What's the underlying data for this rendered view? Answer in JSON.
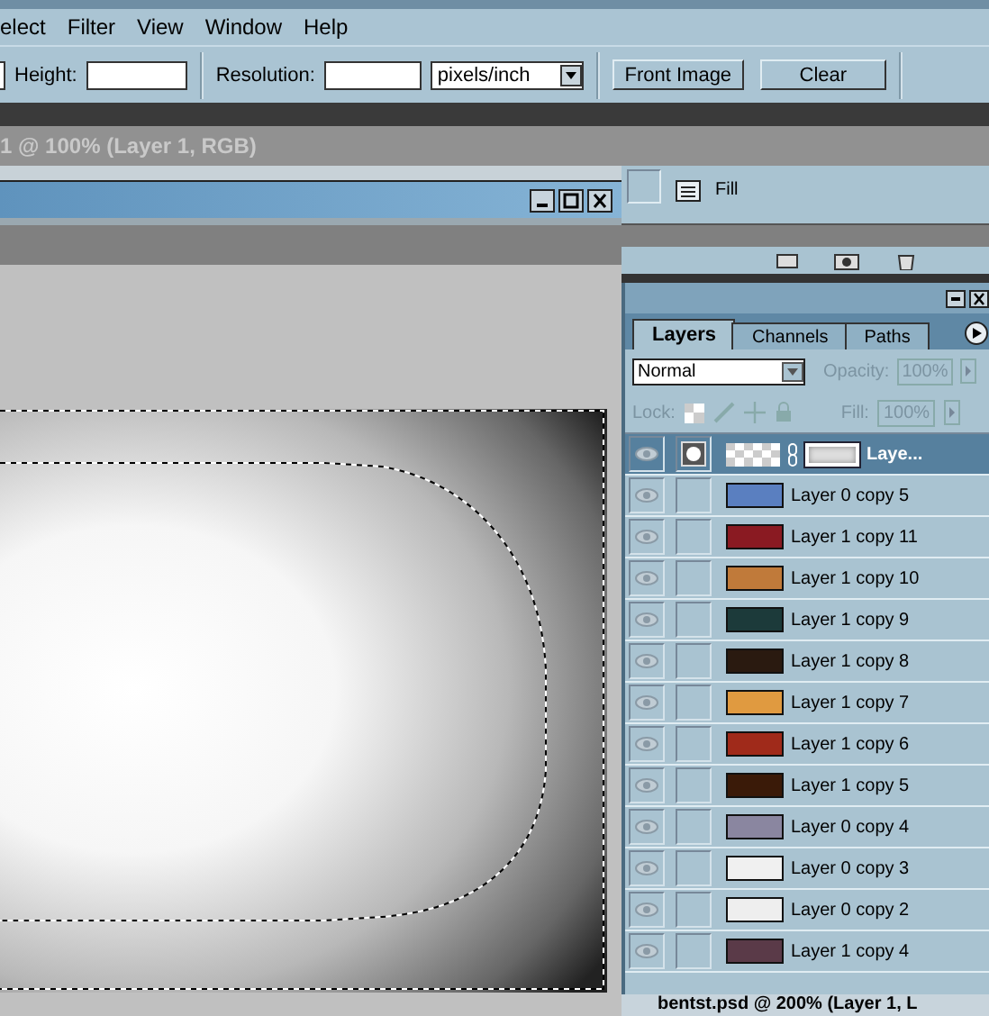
{
  "menu": [
    "elect",
    "Filter",
    "View",
    "Window",
    "Help"
  ],
  "options_bar": {
    "height_label": "Height:",
    "resolution_label": "Resolution:",
    "unit": "pixels/inch",
    "buttons": [
      "Front Image",
      "Clear"
    ]
  },
  "document_title": "1 @ 100% (Layer 1, RGB)",
  "actions_panel": {
    "item": "Fill"
  },
  "layers_palette": {
    "tabs": [
      {
        "label": "Layers",
        "selected": true
      },
      {
        "label": "Channels",
        "selected": false
      },
      {
        "label": "Paths",
        "selected": false
      }
    ],
    "blend_mode": "Normal",
    "opacity_label": "Opacity:",
    "opacity": "100%",
    "lock_label": "Lock:",
    "fill_label": "Fill:",
    "fill": "100%",
    "layers": [
      {
        "name": "Laye...",
        "kind": "mask",
        "selected": true,
        "color": "#ffffff"
      },
      {
        "name": "Layer 0 copy 5",
        "kind": "image",
        "selected": false,
        "color": "#5a7fc0"
      },
      {
        "name": "Layer 1 copy 11",
        "kind": "image",
        "selected": false,
        "color": "#8a1a22"
      },
      {
        "name": "Layer 1 copy 10",
        "kind": "image",
        "selected": false,
        "color": "#c07a3a"
      },
      {
        "name": "Layer 1 copy 9",
        "kind": "image",
        "selected": false,
        "color": "#1c3a3a"
      },
      {
        "name": "Layer 1 copy 8",
        "kind": "image",
        "selected": false,
        "color": "#2a1a10"
      },
      {
        "name": "Layer 1 copy 7",
        "kind": "image",
        "selected": false,
        "color": "#e09a40"
      },
      {
        "name": "Layer 1 copy 6",
        "kind": "image",
        "selected": false,
        "color": "#a02a1a"
      },
      {
        "name": "Layer 1 copy 5",
        "kind": "image",
        "selected": false,
        "color": "#3a1a08"
      },
      {
        "name": "Layer 0 copy 4",
        "kind": "image",
        "selected": false,
        "color": "#8a86a0"
      },
      {
        "name": "Layer 0 copy 3",
        "kind": "image",
        "selected": false,
        "color": "#f0f0f0"
      },
      {
        "name": "Layer 0 copy 2",
        "kind": "image",
        "selected": false,
        "color": "#eeeeee"
      },
      {
        "name": "Layer 1 copy 4",
        "kind": "image",
        "selected": false,
        "color": "#5a3a48"
      }
    ]
  },
  "status_window_title": "bentst.psd @ 200% (Layer 1, L"
}
